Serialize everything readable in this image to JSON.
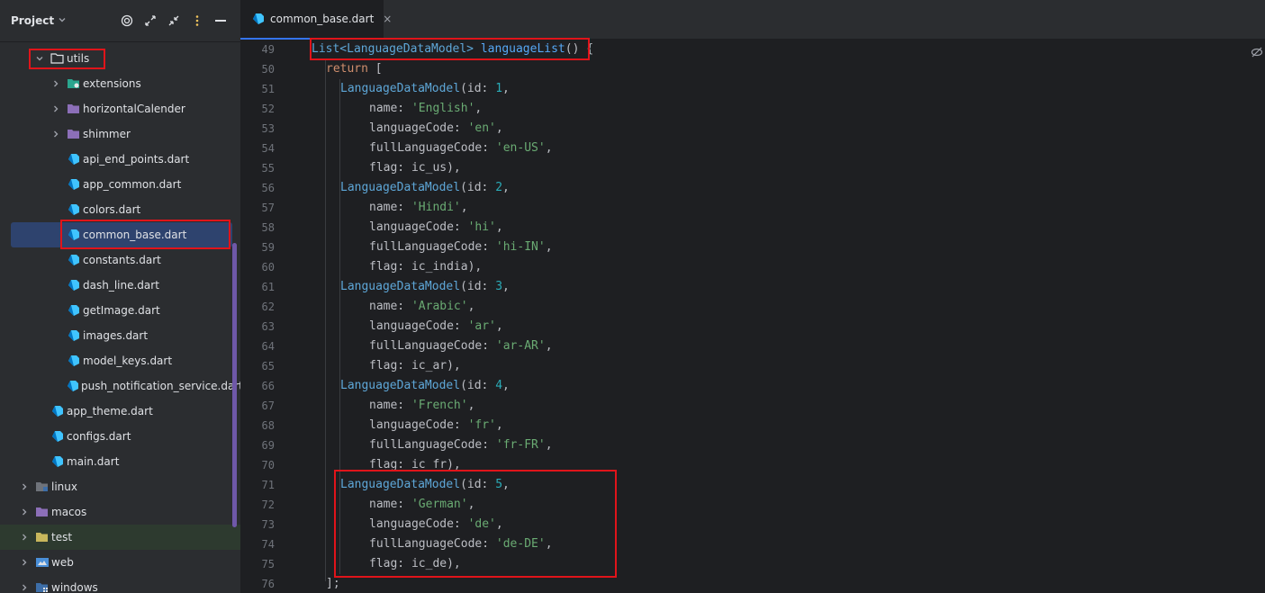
{
  "sidebar": {
    "title": "Project",
    "items": [
      {
        "label": "utils",
        "kind": "folder-open",
        "indent": 1
      },
      {
        "label": "extensions",
        "kind": "folder-ext",
        "indent": 2
      },
      {
        "label": "horizontalCalender",
        "kind": "folder",
        "indent": 2
      },
      {
        "label": "shimmer",
        "kind": "folder",
        "indent": 2
      },
      {
        "label": "api_end_points.dart",
        "kind": "dart",
        "indent": 2
      },
      {
        "label": "app_common.dart",
        "kind": "dart",
        "indent": 2
      },
      {
        "label": "colors.dart",
        "kind": "dart",
        "indent": 2
      },
      {
        "label": "common_base.dart",
        "kind": "dart",
        "indent": 2
      },
      {
        "label": "constants.dart",
        "kind": "dart",
        "indent": 2
      },
      {
        "label": "dash_line.dart",
        "kind": "dart",
        "indent": 2
      },
      {
        "label": "getImage.dart",
        "kind": "dart",
        "indent": 2
      },
      {
        "label": "images.dart",
        "kind": "dart",
        "indent": 2
      },
      {
        "label": "model_keys.dart",
        "kind": "dart",
        "indent": 2
      },
      {
        "label": "push_notification_service.dart",
        "kind": "dart",
        "indent": 2
      },
      {
        "label": "app_theme.dart",
        "kind": "dart",
        "indent": 1
      },
      {
        "label": "configs.dart",
        "kind": "dart",
        "indent": 1
      },
      {
        "label": "main.dart",
        "kind": "dart",
        "indent": 1
      },
      {
        "label": "linux",
        "kind": "folder-linux",
        "indent": 0
      },
      {
        "label": "macos",
        "kind": "folder",
        "indent": 0
      },
      {
        "label": "test",
        "kind": "folder-test",
        "indent": 0
      },
      {
        "label": "web",
        "kind": "folder-web",
        "indent": 0
      },
      {
        "label": "windows",
        "kind": "folder-win",
        "indent": 0
      }
    ]
  },
  "tab": {
    "label": "common_base.dart",
    "close": "×"
  },
  "editor": {
    "line_numbers": [
      "49",
      "50",
      "51",
      "52",
      "53",
      "54",
      "55",
      "56",
      "57",
      "58",
      "59",
      "60",
      "61",
      "62",
      "63",
      "64",
      "65",
      "66",
      "67",
      "68",
      "69",
      "70",
      "71",
      "72",
      "73",
      "74",
      "75",
      "76"
    ],
    "code": {
      "l49_type": "List<LanguageDataModel>",
      "l49_fn": "languageList",
      "l49_rest": "() {",
      "l50_kw": "return",
      "l50_rest": " [",
      "entries": [
        {
          "model": "LanguageDataModel",
          "id_label": "id:",
          "id": "1",
          "name": "'English'",
          "code": "'en'",
          "full": "'en-US'",
          "flag": "ic_us"
        },
        {
          "model": "LanguageDataModel",
          "id_label": "id:",
          "id": "2",
          "name": "'Hindi'",
          "code": "'hi'",
          "full": "'hi-IN'",
          "flag": "ic_india"
        },
        {
          "model": "LanguageDataModel",
          "id_label": "id:",
          "id": "3",
          "name": "'Arabic'",
          "code": "'ar'",
          "full": "'ar-AR'",
          "flag": "ic_ar"
        },
        {
          "model": "LanguageDataModel",
          "id_label": "id:",
          "id": "4",
          "name": "'French'",
          "code": "'fr'",
          "full": "'fr-FR'",
          "flag": "ic_fr"
        },
        {
          "model": "LanguageDataModel",
          "id_label": "id:",
          "id": "5",
          "name": "'German'",
          "code": "'de'",
          "full": "'de-DE'",
          "flag": "ic_de"
        }
      ],
      "name_label": "name:",
      "code_label": "languageCode:",
      "full_label": "fullLanguageCode:",
      "flag_label": "flag:",
      "l76": "];"
    }
  },
  "colors": {
    "highlight": "#e0141a",
    "selection": "#2e436e",
    "accent": "#3574f0"
  }
}
